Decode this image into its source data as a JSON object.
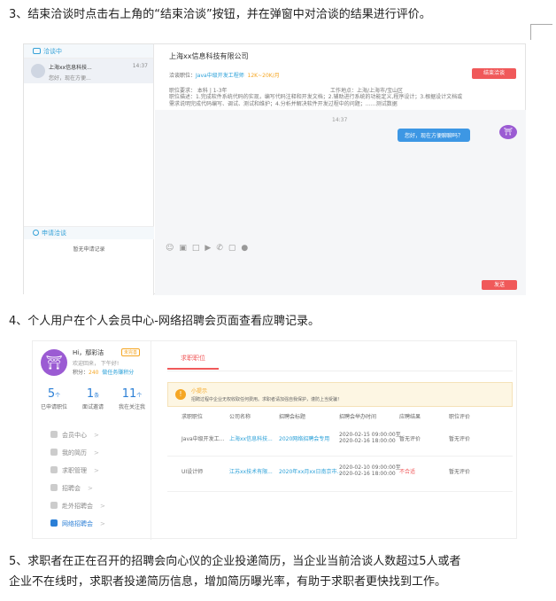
{
  "step3": "3、结束洽谈时点击右上角的“结束洽谈”按钮，并在弹窗中对洽谈的结果进行评价。",
  "step4": "4、个人用户在个人会员中心-网络招聘会页面查看应聘记录。",
  "step5_line1": "5、求职者在正在召开的招聘会向心仪的企业投递简历，当企业当前洽谈人数超过5人或者",
  "step5_line2": "企业不在线时，求职者投递简历信息，增加简历曝光率，有助于求职者更快找到工作。",
  "shot1": {
    "left_title": "洽谈中",
    "chat_item": {
      "name": "上海xx信息科技...",
      "msg": "您好，现在方便...",
      "time": "14:37"
    },
    "apply_title": "申请洽谈",
    "no_apply": "暂无申请记录",
    "company": "上海xx信息科技有限公司",
    "job_prefix": "洽谈职位：",
    "job_name": "Java中级开发工程师",
    "salary": "12K~20K/月",
    "end_button": "结束洽谈",
    "requirements": "职位要求：  本科  |  1-3年",
    "location": "工作地点：上海/上海市/宝山区",
    "desc1": "职位描述：1.完成软件系统代码的实现，编写代码注释和开发文档；2.辅助进行系统的功能定义,程序设计；3.根据设计文档或",
    "desc2": "需求说明完成代码编写、调试、测试和维护；4.分析并解决软件开发过程中的问题；……测试数据",
    "chat_time": "14:37",
    "bubble": "您好，现在方便聊聊吗？",
    "send": "发送"
  },
  "shot2": {
    "greeting": "Hi，鄢彩洁",
    "badge": "未完善",
    "welcome": "欢迎回来，  下午好!",
    "points_label": "积分：",
    "points": "240",
    "points_link": "做任务赚积分",
    "stats": [
      {
        "num": "5",
        "unit": "个",
        "label": "已申请职位"
      },
      {
        "num": "1",
        "unit": "条",
        "label": "面试邀请"
      },
      {
        "num": "11",
        "unit": "个",
        "label": "我在关注我"
      }
    ],
    "menu": [
      "会员中心",
      "我的简历",
      "求职管理",
      "招聘会",
      "赴外招聘会",
      "网络招聘会"
    ],
    "tab": "求职职位",
    "tip_title": "小提示",
    "tip_text": "招聘过程中企业无权收取任何费用。求职者请加强自我保护，谨防上当受骗！",
    "headers": [
      "求职职位",
      "公司名称",
      "招聘会标题",
      "招聘会举办时间",
      "应聘结果",
      "职位评价"
    ],
    "rows": [
      {
        "job": "Java中级开发工...",
        "company": "上海xx信息科技...",
        "fair": "2020网络招聘会专用",
        "t1": "2020-02-15 09:00:00至",
        "t2": "2020-02-16 18:00:00",
        "result": "暂无评价",
        "eval": "暂无评价"
      },
      {
        "job": "UI设计师",
        "company": "江苏xx技术有限...",
        "fair": "2020年xx月xx日南京市...",
        "t1": "2020-02-10 09:00:00至",
        "t2": "2020-02-16 18:00:00",
        "result": "不合适",
        "eval": "暂无评价"
      }
    ]
  }
}
